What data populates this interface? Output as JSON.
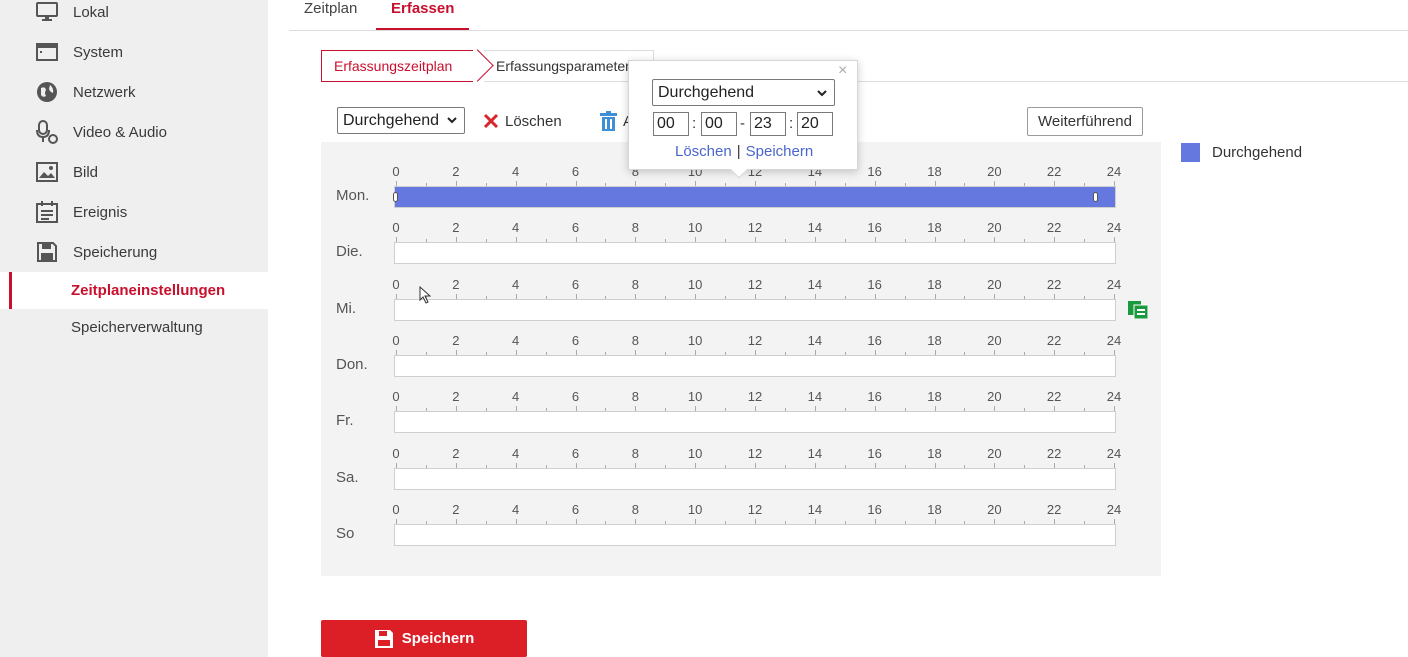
{
  "sidebar": {
    "items": [
      {
        "label": "Lokal",
        "icon": "monitor-icon"
      },
      {
        "label": "System",
        "icon": "system-window-icon"
      },
      {
        "label": "Netzwerk",
        "icon": "globe-icon"
      },
      {
        "label": "Video & Audio",
        "icon": "microphone-camera-icon"
      },
      {
        "label": "Bild",
        "icon": "image-icon"
      },
      {
        "label": "Ereignis",
        "icon": "calendar-list-icon"
      },
      {
        "label": "Speicherung",
        "icon": "floppy-disk-icon"
      }
    ],
    "subitems": [
      {
        "label": "Zeitplaneinstellungen",
        "active": true
      },
      {
        "label": "Speicherverwaltung",
        "active": false
      }
    ]
  },
  "tabs": {
    "zeitplan": "Zeitplan",
    "erfassen": "Erfassen"
  },
  "steps": {
    "step1": "Erfassungszeitplan",
    "step2": "Erfassungsparameter"
  },
  "toolbar": {
    "mode_value": "Durchgehend",
    "clear_label": "Löschen",
    "delete_all_label": "A",
    "advanced_label": "Weiterführend"
  },
  "legend": {
    "label": "Durchgehend",
    "color": "#6478e0"
  },
  "schedule": {
    "ticks": [
      "0",
      "2",
      "4",
      "6",
      "8",
      "10",
      "12",
      "14",
      "16",
      "18",
      "20",
      "22",
      "24"
    ],
    "days": [
      {
        "label": "Mon.",
        "segments": [
          {
            "start": 0,
            "end": 23.333,
            "type": "Durchgehend"
          }
        ]
      },
      {
        "label": "Die.",
        "segments": []
      },
      {
        "label": "Mi.",
        "segments": []
      },
      {
        "label": "Don.",
        "segments": []
      },
      {
        "label": "Fr.",
        "segments": []
      },
      {
        "label": "Sa.",
        "segments": []
      },
      {
        "label": "So",
        "segments": []
      }
    ]
  },
  "popup": {
    "mode_value": "Durchgehend",
    "start_hour": "00",
    "start_min": "00",
    "end_hour": "23",
    "end_min": "20",
    "colon": ":",
    "dash": "-",
    "delete_label": "Löschen",
    "separator": "|",
    "save_label": "Speichern",
    "close": "×"
  },
  "save_button": {
    "label": "Speichern"
  }
}
